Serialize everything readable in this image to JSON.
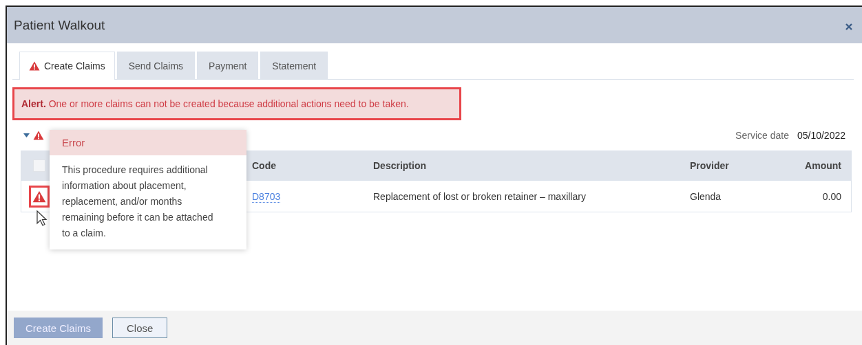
{
  "dialog": {
    "title": "Patient Walkout"
  },
  "tabs": [
    {
      "label": "Create Claims",
      "selected": true,
      "warning": true
    },
    {
      "label": "Send Claims",
      "selected": false,
      "warning": false
    },
    {
      "label": "Payment",
      "selected": false,
      "warning": false
    },
    {
      "label": "Statement",
      "selected": false,
      "warning": false
    }
  ],
  "alert": {
    "text": "**Alert.** One or more claims can not be created because additional actions need to be taken."
  },
  "group": {
    "expanded": true,
    "warning": true
  },
  "service_date": {
    "label": "Service date",
    "value": "05/10/2022"
  },
  "table": {
    "columns": [
      "Code",
      "Description",
      "Provider",
      "Amount"
    ],
    "select_all_checked": false,
    "rows": [
      {
        "code": "D8703",
        "description": "Replacement of lost or broken retainer – maxillary",
        "provider": "Glenda",
        "amount": "0.00",
        "error": true
      }
    ]
  },
  "tooltip": {
    "title": "Error",
    "body": "This procedure requires additional information about placement, replacement, and/or months remaining before it can be attached to a claim."
  },
  "buttons": [
    {
      "label": "Create Claims",
      "kind": "primary",
      "disabled": true
    },
    {
      "label": "Close",
      "kind": "secondary",
      "disabled": false
    }
  ]
}
